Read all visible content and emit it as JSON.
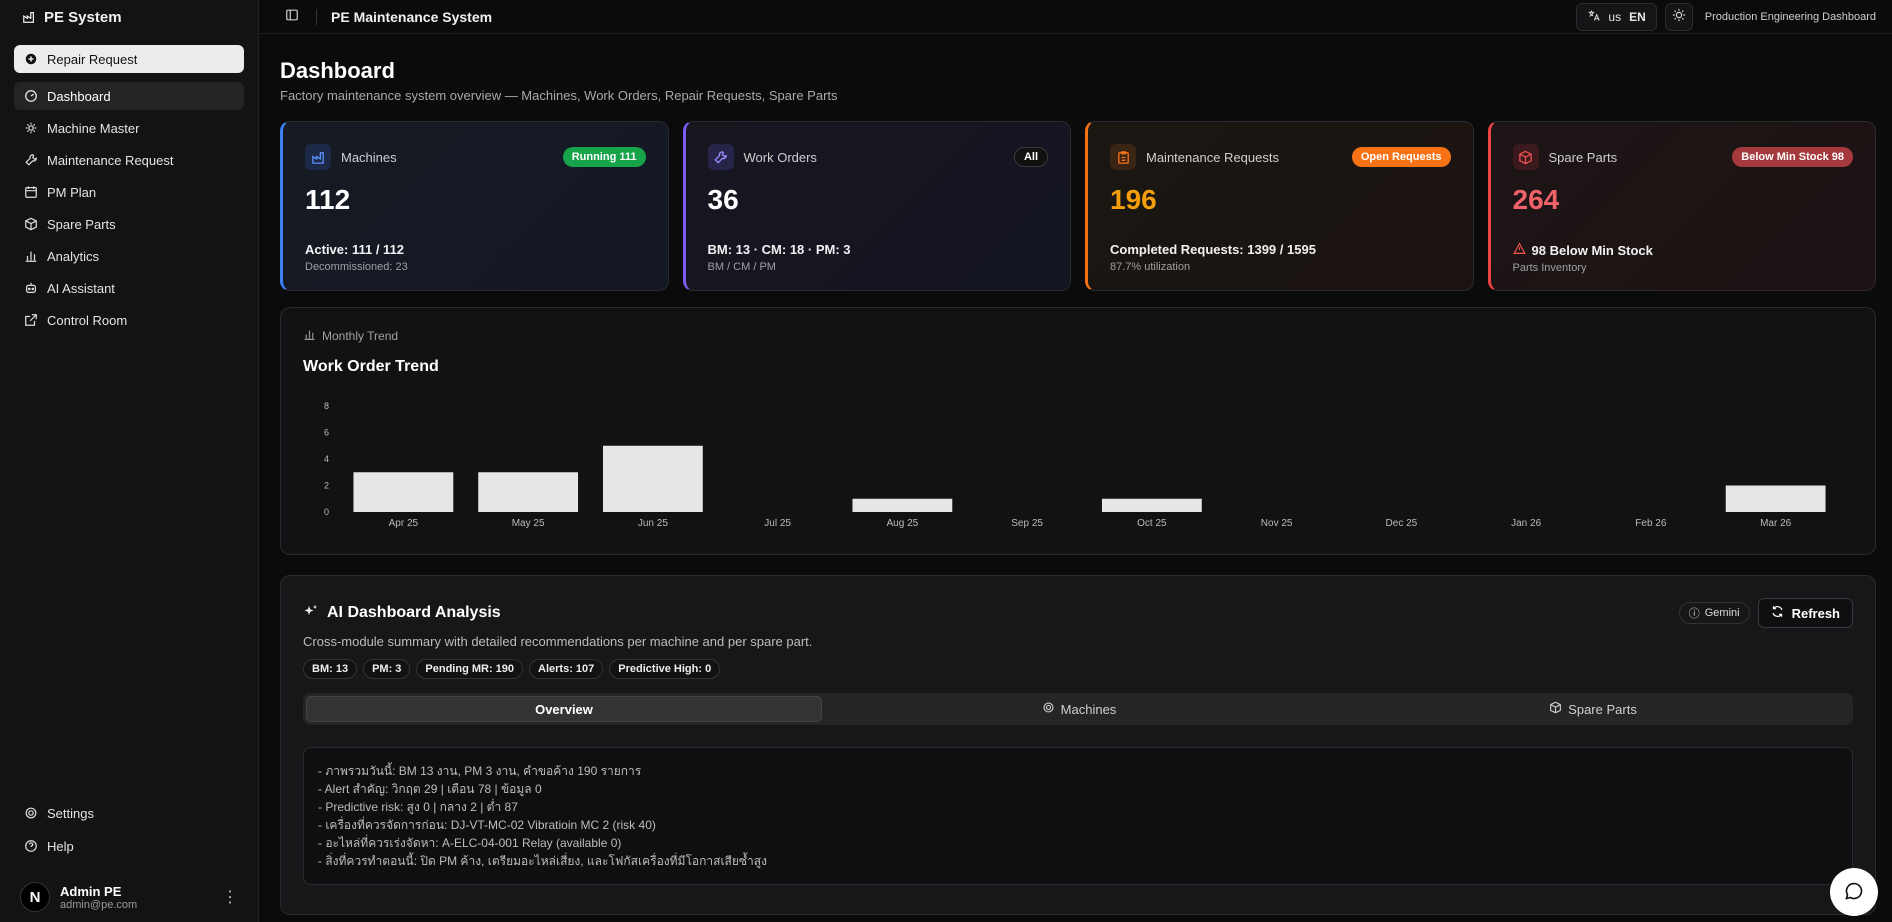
{
  "app": {
    "brand": "PE System"
  },
  "sidebar": {
    "primary": {
      "label": "Repair Request",
      "icon": "plus-circle-icon"
    },
    "items": [
      {
        "label": "Dashboard",
        "icon": "gauge-icon",
        "active": true
      },
      {
        "label": "Machine Master",
        "icon": "cog-icon"
      },
      {
        "label": "Maintenance Request",
        "icon": "wrench-icon"
      },
      {
        "label": "PM Plan",
        "icon": "calendar-icon"
      },
      {
        "label": "Spare Parts",
        "icon": "package-icon"
      },
      {
        "label": "Analytics",
        "icon": "bar-chart-icon"
      },
      {
        "label": "AI Assistant",
        "icon": "bot-icon"
      },
      {
        "label": "Control Room",
        "icon": "external-link-icon"
      }
    ],
    "bottom": [
      {
        "label": "Settings",
        "icon": "gear-icon"
      },
      {
        "label": "Help",
        "icon": "help-circle-icon"
      }
    ],
    "user": {
      "initial": "N",
      "name": "Admin PE",
      "email": "admin@pe.com"
    }
  },
  "topbar": {
    "title": "PE Maintenance System",
    "lang_region": "us",
    "lang_code": "EN",
    "subtitle": "Production Engineering Dashboard"
  },
  "page": {
    "title": "Dashboard",
    "subtitle": "Factory maintenance system overview — Machines, Work Orders, Repair Requests, Spare Parts"
  },
  "cards": {
    "machines": {
      "label": "Machines",
      "badge": "Running 111",
      "value": "112",
      "line": "Active: 111 / 112",
      "small": "Decommissioned: 23",
      "color": "#3b82f6"
    },
    "work_orders": {
      "label": "Work Orders",
      "badge": "All",
      "value": "36",
      "line": "BM: 13 · CM: 18 · PM: 3",
      "small": "BM / CM / PM",
      "color": "#7c5cf0"
    },
    "maintenance": {
      "label": "Maintenance Requests",
      "badge": "Open Requests",
      "value": "196",
      "line": "Completed Requests: 1399 / 1595",
      "small": "87.7% utilization",
      "color": "#f97316"
    },
    "spare": {
      "label": "Spare Parts",
      "badge": "Below Min Stock 98",
      "value": "264",
      "line": "98 Below Min Stock",
      "small": "Parts Inventory",
      "color": "#ef4444"
    }
  },
  "trend": {
    "kicker": "Monthly Trend",
    "title": "Work Order Trend"
  },
  "chart_data": {
    "type": "bar",
    "categories": [
      "Apr 25",
      "May 25",
      "Jun 25",
      "Jul 25",
      "Aug 25",
      "Sep 25",
      "Oct 25",
      "Nov 25",
      "Dec 25",
      "Jan 26",
      "Feb 26",
      "Mar 26"
    ],
    "values": [
      3,
      3,
      5,
      0,
      1,
      0,
      1,
      0,
      0,
      0,
      0,
      2
    ],
    "yticks": [
      0,
      2,
      4,
      6,
      8
    ],
    "ylim": [
      0,
      8
    ],
    "title": "Work Order Trend",
    "bar_color": "#e6e6e6"
  },
  "ai": {
    "title": "AI Dashboard Analysis",
    "description": "Cross-module summary with detailed recommendations per machine and per spare part.",
    "model_badge": "Gemini",
    "refresh_label": "Refresh",
    "chips": [
      "BM: 13",
      "PM: 3",
      "Pending MR: 190",
      "Alerts: 107",
      "Predictive High: 0"
    ],
    "tabs": [
      {
        "label": "Overview",
        "active": true
      },
      {
        "label": "Machines",
        "icon": "cog-icon"
      },
      {
        "label": "Spare Parts",
        "icon": "package-icon"
      }
    ],
    "output": [
      "- ภาพรวมวันนี้: BM 13 งาน, PM 3 งาน, คำขอค้าง 190 รายการ",
      "- Alert สำคัญ: วิกฤต 29 | เตือน 78 | ข้อมูล 0",
      "- Predictive risk: สูง 0 | กลาง 2 | ต่ำ 87",
      "- เครื่องที่ควรจัดการก่อน: DJ-VT-MC-02 Vibratioin MC 2 (risk 40)",
      "- อะไหล่ที่ควรเร่งจัดหา: A-ELC-04-001 Relay (available 0)",
      "- สิ่งที่ควรทำตอนนี้: ปิด PM ค้าง, เตรียมอะไหล่เสี่ยง, และโฟกัสเครื่องที่มีโอกาสเสียซ้ำสูง"
    ]
  }
}
